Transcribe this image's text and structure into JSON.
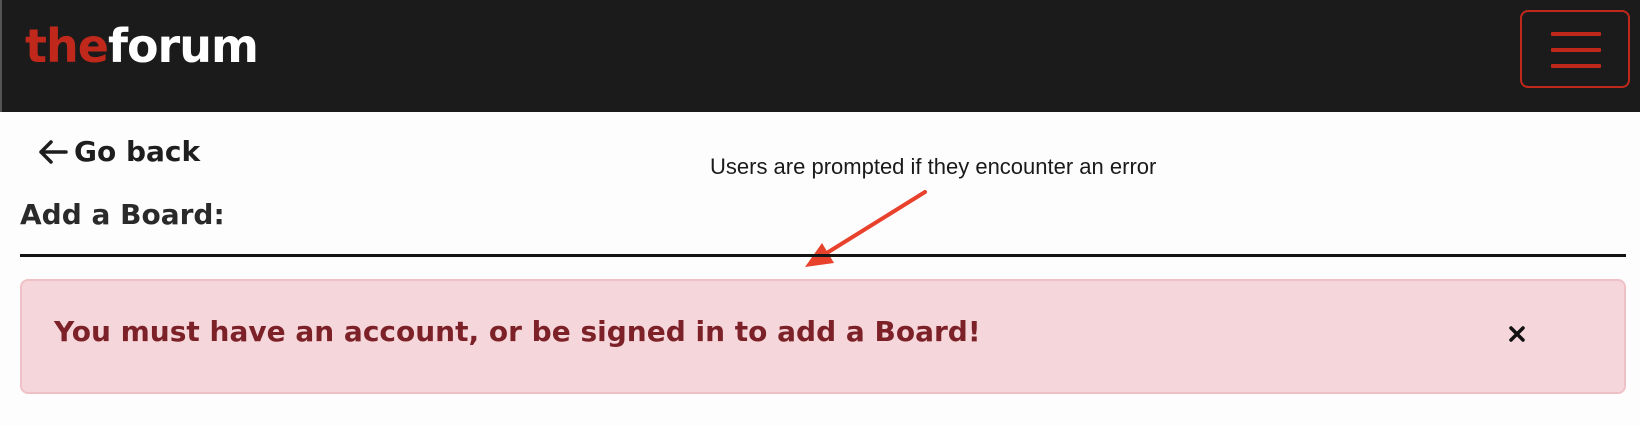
{
  "navbar": {
    "logo_part_1": "the",
    "logo_part_2": "forum",
    "menu_icon": "hamburger-menu-icon",
    "accent_color": "#c0281c",
    "background_color": "#1b1b1b"
  },
  "nav": {
    "back_label": "Go back",
    "back_icon": "arrow-left-icon"
  },
  "page": {
    "title": "Add a Board:"
  },
  "alert": {
    "message": "You must have an account, or be signed in to add a Board!",
    "close_icon": "close-icon",
    "background_color": "#f5d6da",
    "text_color": "#7c2128"
  },
  "annotation": {
    "text": "Users are prompted if they encounter an error",
    "arrow_color": "#e8412c"
  }
}
